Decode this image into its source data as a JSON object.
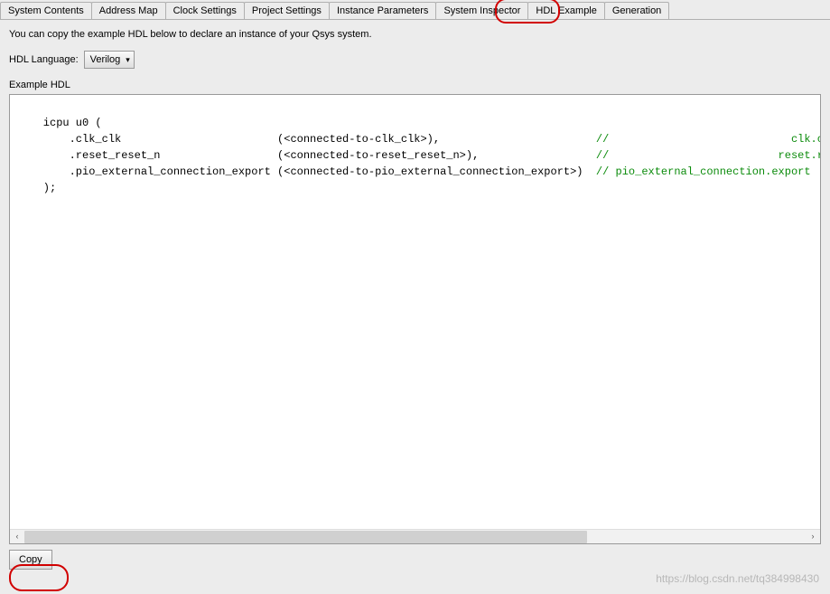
{
  "tabs": {
    "t0": "System Contents",
    "t1": "Address Map",
    "t2": "Clock Settings",
    "t3": "Project Settings",
    "t4": "Instance Parameters",
    "t5": "System Inspector",
    "t6": "HDL Example",
    "t7": "Generation"
  },
  "info": "You can copy the example HDL below to declare an instance of your Qsys system.",
  "lang_label": "HDL Language:",
  "lang_value": "Verilog",
  "example_label": "Example HDL",
  "code": {
    "l0": "    icpu u0 (",
    "l1a": "        .clk_clk                        (<connected-to-clk_clk>),                        ",
    "l1b": "//                            clk.clk",
    "l2a": "        .reset_reset_n                  (<connected-to-reset_reset_n>),                  ",
    "l2b": "//                          reset.reset_n",
    "l3a": "        .pio_external_connection_export (<connected-to-pio_external_connection_export>)  ",
    "l3b": "// pio_external_connection.export",
    "l4": "    );"
  },
  "copy_label": "Copy",
  "watermark": "https://blog.csdn.net/tq384998430"
}
